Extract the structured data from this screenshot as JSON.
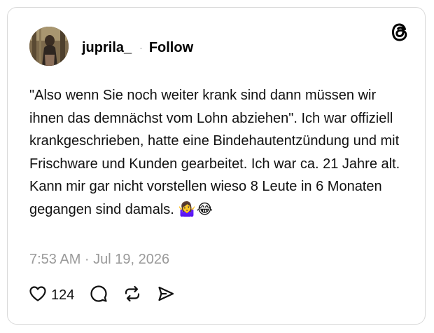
{
  "post": {
    "author": {
      "username": "juprila_",
      "separator": "·",
      "follow_label": "Follow"
    },
    "text": "\"Also wenn Sie noch weiter krank sind dann müssen wir ihnen das demnächst vom Lohn abziehen\". Ich war offiziell krankgeschrieben, hatte eine Bindehautentzündung und mit Frischware und Kunden gearbeitet. Ich war ca. 21 Jahre alt. Kann mir gar nicht vorstellen wieso 8 Leute in 6 Monaten gegangen sind damals.",
    "emojis": "🤷‍♀️😂",
    "timestamp": "7:53 AM · Jul 19, 2026",
    "likes": "124"
  },
  "icons": {
    "logo": "threads-logo-icon",
    "like": "heart-icon",
    "comment": "comment-bubble-icon",
    "repost": "repost-icon",
    "share": "send-icon"
  },
  "colors": {
    "text": "#111111",
    "muted": "#9a9a9a",
    "border": "#d9d9d9",
    "background": "#ffffff"
  }
}
